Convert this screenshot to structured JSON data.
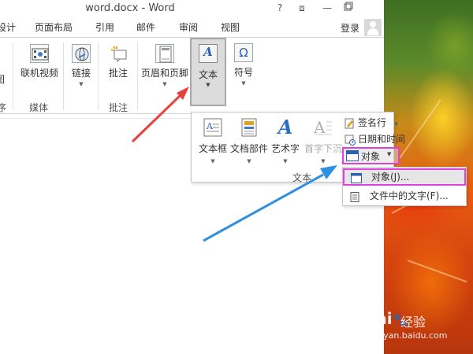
{
  "window": {
    "title": "word.docx - Word",
    "help": "?",
    "restore": "⧈",
    "minimize": "—"
  },
  "tabs": [
    "设计",
    "页面布局",
    "引用",
    "邮件",
    "审阅",
    "视图"
  ],
  "account": {
    "login": "登录"
  },
  "ribbon": {
    "buttons": {
      "video": "联机视频",
      "link": "链接",
      "comment": "批注",
      "header_footer": "页眉和页脚",
      "text": "文本",
      "symbol": "符号"
    },
    "groups": {
      "media": "媒体",
      "comment": "批注",
      "left_cut": "序",
      "left_cut2": "图"
    }
  },
  "text_panel": {
    "buttons": {
      "textbox": "文本框",
      "quickparts": "文档部件",
      "wordart": "艺术字",
      "dropcap": "首字下沉"
    },
    "small": {
      "signature": "签名行",
      "datetime": "日期和时间",
      "object": "对象"
    },
    "group_label": "文本"
  },
  "object_menu": {
    "items": [
      "对象(J)...",
      "文件中的文字(F)..."
    ]
  },
  "watermark": {
    "brand": "Bai",
    "brand2": "经验",
    "url": "jingyan.baidu.com"
  },
  "colors": {
    "highlight": "#e040e0",
    "red_arrow": "#e8403c",
    "blue_arrow": "#2f8fe0"
  }
}
